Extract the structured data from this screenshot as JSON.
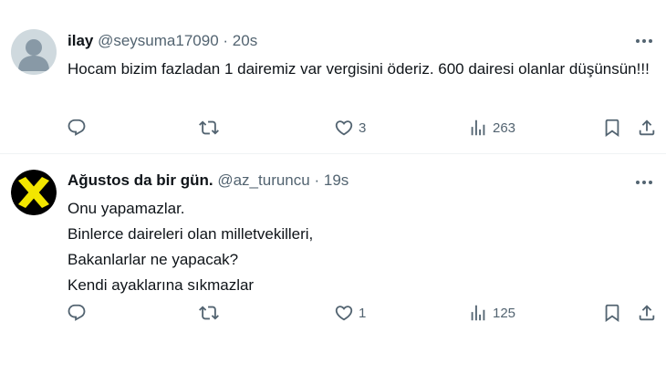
{
  "tweets": [
    {
      "name": "ilay",
      "handle": "@seysuma17090",
      "separator": "·",
      "time": "20s",
      "text": "Hocam bizim fazladan 1 dairemiz var vergisini öderiz. 600 dairesi olanlar düşünsün!!!",
      "likes": "3",
      "views": "263",
      "avatar_colors": {
        "bg": "#cfd9de",
        "fg": "#8899a6"
      }
    },
    {
      "name": "Ağustos da bir gün.",
      "handle": "@az_turuncu",
      "separator": "·",
      "time": "19s",
      "lines": [
        "Onu yapamazlar.",
        "Binlerce daireleri olan milletvekilleri,",
        "Bakanlarlar ne yapacak?",
        "Kendi ayaklarına sıkmazlar"
      ],
      "likes": "1",
      "views": "125",
      "avatar_colors": {
        "bg": "#000000",
        "fg": "#f2e600"
      }
    }
  ],
  "icons": {
    "reply": "reply-icon",
    "retweet": "retweet-icon",
    "like": "like-icon",
    "views": "views-icon",
    "bookmark": "bookmark-icon",
    "share": "share-icon",
    "more": "more-icon"
  },
  "colors": {
    "secondary_text": "#536471",
    "primary_text": "#0f1419",
    "divider": "#eff3f4"
  }
}
